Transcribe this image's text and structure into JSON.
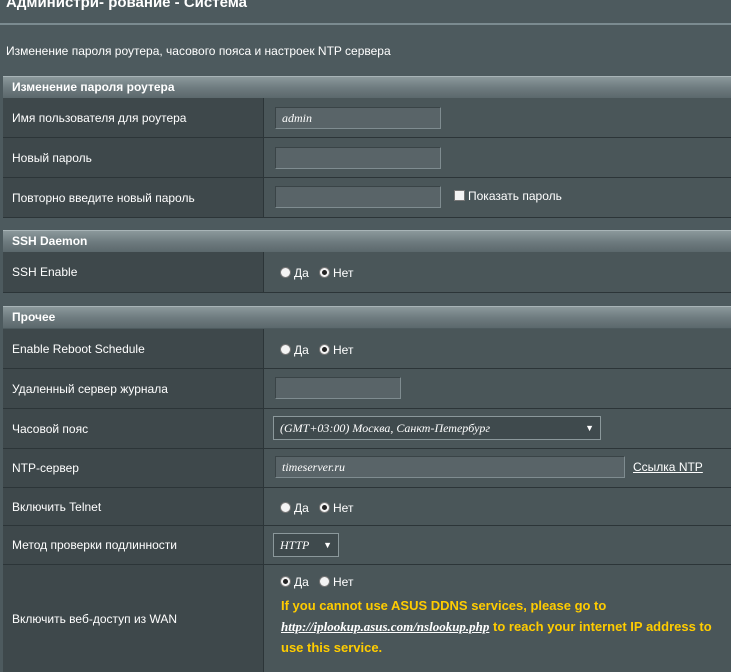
{
  "page": {
    "title": "Администри- рование - Система",
    "subtitle": "Изменение пароля роутера, часового пояса и настроек NTP сервера"
  },
  "password_section": {
    "title": "Изменение пароля роутера",
    "username_label": "Имя пользователя для роутера",
    "username_value": "admin",
    "new_password_label": "Новый пароль",
    "new_password_value": "",
    "repeat_password_label": "Повторно введите новый пароль",
    "repeat_password_value": "",
    "show_password_label": "Показать пароль",
    "show_password_checked": false
  },
  "ssh_section": {
    "title": "SSH Daemon",
    "ssh_enable_label": "SSH Enable",
    "yes_label": "Да",
    "no_label": "Нет",
    "selected": "no"
  },
  "misc_section": {
    "title": "Прочее",
    "reboot_label": "Enable Reboot Schedule",
    "reboot_yes": "Да",
    "reboot_no": "Нет",
    "reboot_selected": "no",
    "remote_log_label": "Удаленный сервер журнала",
    "remote_log_value": "",
    "timezone_label": "Часовой пояс",
    "timezone_value": "(GMT+03:00) Москва, Санкт-Петербург",
    "ntp_label": "NTP-сервер",
    "ntp_value": "timeserver.ru",
    "ntp_link": "Ссылка NTP",
    "telnet_label": "Включить Telnet",
    "telnet_yes": "Да",
    "telnet_no": "Нет",
    "telnet_selected": "no",
    "auth_label": "Метод проверки подлинности",
    "auth_value": "HTTP",
    "wan_label": "Включить веб-доступ из WAN",
    "wan_yes": "Да",
    "wan_no": "Нет",
    "wan_selected": "yes",
    "wan_warning_prefix": "If you cannot use ASUS DDNS services, please go to",
    "wan_warning_link": "http://iplookup.asus.com/nslookup.php",
    "wan_warning_suffix": "to reach your internet IP address to use this service."
  },
  "colors": {
    "background": "#4d5a5e",
    "label_cell": "#3e484b",
    "value_cell": "#4a5659",
    "warning": "#ffcc00"
  }
}
